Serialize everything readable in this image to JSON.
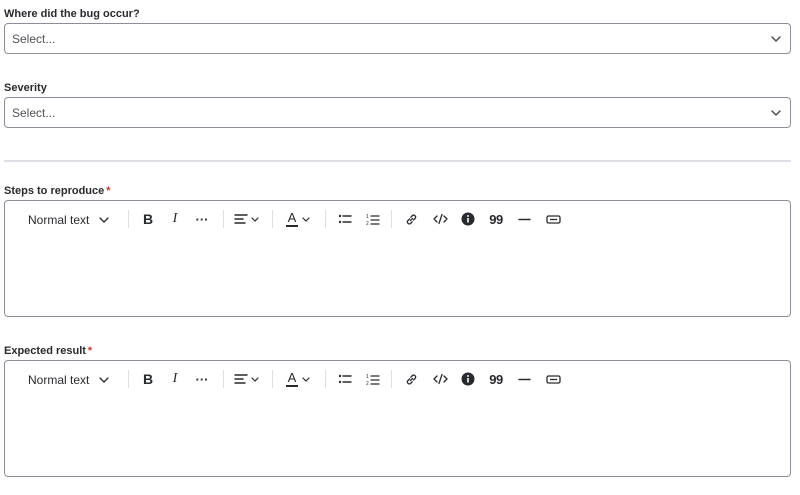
{
  "fields": {
    "location": {
      "label": "Where did the bug occur?",
      "value": "Select..."
    },
    "severity": {
      "label": "Severity",
      "value": "Select..."
    },
    "steps": {
      "label": "Steps to reproduce",
      "required_mark": "*"
    },
    "expected": {
      "label": "Expected result",
      "required_mark": "*"
    }
  },
  "toolbar": {
    "text_style": "Normal text",
    "bold": "B",
    "italic": "I",
    "more": "···",
    "color_letter": "A",
    "quote": "99"
  },
  "colors": {
    "required": "#c9372c",
    "border": "#8c8f97",
    "divider": "#dcdfe4",
    "text": "#292a2e"
  }
}
